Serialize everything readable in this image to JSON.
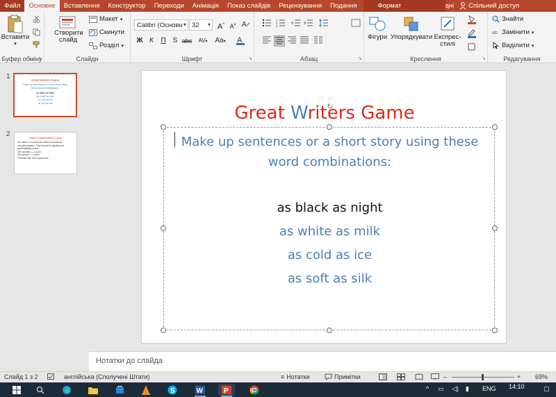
{
  "tabs": [
    "Файл",
    "Основне",
    "Вставлення",
    "Конструктор",
    "Переходи",
    "Анімація",
    "Показ слайдів",
    "Рецензування",
    "Подання",
    "Формат"
  ],
  "active_tab": "Основне",
  "help_label": "Докладні",
  "share_label": "Спільний доступ",
  "ribbon": {
    "clipboard": {
      "paste": "Вставити",
      "label": "Буфер обміну"
    },
    "slides": {
      "new_slide": "Створити слайд",
      "layout": "Макет",
      "reset": "Скинути",
      "section": "Розділ",
      "label": "Слайди"
    },
    "font": {
      "family": "Calibri (Основн",
      "size": "32",
      "bold": "Ж",
      "italic": "К",
      "underline": "П",
      "strike": "S",
      "spacing": "AV",
      "case": "Aa",
      "label": "Шрифт"
    },
    "paragraph": {
      "label": "Абзац"
    },
    "drawing": {
      "shapes": "Фігури",
      "arrange": "Упорядкувати",
      "quick_styles": "Експрес-стилі",
      "label": "Креслення"
    },
    "editing": {
      "find": "Знайти",
      "replace": "Замінити",
      "select": "Виділити",
      "label": "Редагування"
    }
  },
  "slide_numbers": [
    "1",
    "2"
  ],
  "thumb1": {
    "title": "Great Writers Game",
    "sub": "Make up sentences or a short story using these word combinations:",
    "lines": [
      "as black as night",
      "as white as milk",
      "as cold as ice",
      "as soft as silk"
    ]
  },
  "thumb2": {
    "title": "Obent Conversation Game",
    "body": [
      "Two teams. You ask each other the questions",
      "and give answers. They should be logically and",
      "grammatically correct.",
      "One question — 1 point",
      "One answer — 1 point",
      "The team with more points wins."
    ]
  },
  "slide": {
    "title_parts": [
      "Great ",
      "W",
      "riters Game"
    ],
    "intro": "Make up sentences or a short story using these word combinations:",
    "lines": [
      "as black as night",
      "as white as milk",
      "as cold as ice",
      "as soft as silk"
    ]
  },
  "notes_placeholder": "Нотатки до слайда",
  "status": {
    "slide_info": "Слайд 1 з 2",
    "language": "англійська (Сполучені Штати)",
    "notes": "Нотатки",
    "comments": "Примітки",
    "zoom": "69%"
  },
  "taskbar": {
    "lang": "ENG",
    "time": "14:10"
  },
  "colors": {
    "accent": "#b7472a",
    "title_red": "#e0271a",
    "body_blue": "#4a7fb5"
  }
}
